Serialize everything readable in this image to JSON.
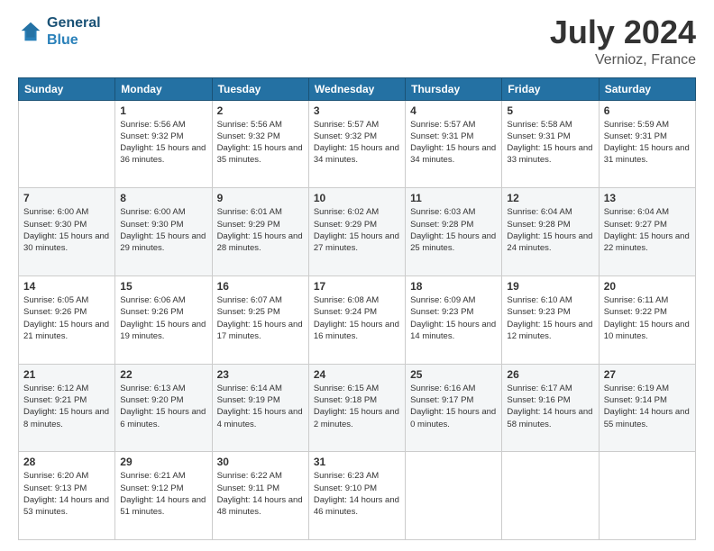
{
  "header": {
    "logo_line1": "General",
    "logo_line2": "Blue",
    "title": "July 2024",
    "subtitle": "Vernioz, France"
  },
  "days_of_week": [
    "Sunday",
    "Monday",
    "Tuesday",
    "Wednesday",
    "Thursday",
    "Friday",
    "Saturday"
  ],
  "weeks": [
    [
      {
        "day": "",
        "sunrise": "",
        "sunset": "",
        "daylight": ""
      },
      {
        "day": "1",
        "sunrise": "Sunrise: 5:56 AM",
        "sunset": "Sunset: 9:32 PM",
        "daylight": "Daylight: 15 hours and 36 minutes."
      },
      {
        "day": "2",
        "sunrise": "Sunrise: 5:56 AM",
        "sunset": "Sunset: 9:32 PM",
        "daylight": "Daylight: 15 hours and 35 minutes."
      },
      {
        "day": "3",
        "sunrise": "Sunrise: 5:57 AM",
        "sunset": "Sunset: 9:32 PM",
        "daylight": "Daylight: 15 hours and 34 minutes."
      },
      {
        "day": "4",
        "sunrise": "Sunrise: 5:57 AM",
        "sunset": "Sunset: 9:31 PM",
        "daylight": "Daylight: 15 hours and 34 minutes."
      },
      {
        "day": "5",
        "sunrise": "Sunrise: 5:58 AM",
        "sunset": "Sunset: 9:31 PM",
        "daylight": "Daylight: 15 hours and 33 minutes."
      },
      {
        "day": "6",
        "sunrise": "Sunrise: 5:59 AM",
        "sunset": "Sunset: 9:31 PM",
        "daylight": "Daylight: 15 hours and 31 minutes."
      }
    ],
    [
      {
        "day": "7",
        "sunrise": "Sunrise: 6:00 AM",
        "sunset": "Sunset: 9:30 PM",
        "daylight": "Daylight: 15 hours and 30 minutes."
      },
      {
        "day": "8",
        "sunrise": "Sunrise: 6:00 AM",
        "sunset": "Sunset: 9:30 PM",
        "daylight": "Daylight: 15 hours and 29 minutes."
      },
      {
        "day": "9",
        "sunrise": "Sunrise: 6:01 AM",
        "sunset": "Sunset: 9:29 PM",
        "daylight": "Daylight: 15 hours and 28 minutes."
      },
      {
        "day": "10",
        "sunrise": "Sunrise: 6:02 AM",
        "sunset": "Sunset: 9:29 PM",
        "daylight": "Daylight: 15 hours and 27 minutes."
      },
      {
        "day": "11",
        "sunrise": "Sunrise: 6:03 AM",
        "sunset": "Sunset: 9:28 PM",
        "daylight": "Daylight: 15 hours and 25 minutes."
      },
      {
        "day": "12",
        "sunrise": "Sunrise: 6:04 AM",
        "sunset": "Sunset: 9:28 PM",
        "daylight": "Daylight: 15 hours and 24 minutes."
      },
      {
        "day": "13",
        "sunrise": "Sunrise: 6:04 AM",
        "sunset": "Sunset: 9:27 PM",
        "daylight": "Daylight: 15 hours and 22 minutes."
      }
    ],
    [
      {
        "day": "14",
        "sunrise": "Sunrise: 6:05 AM",
        "sunset": "Sunset: 9:26 PM",
        "daylight": "Daylight: 15 hours and 21 minutes."
      },
      {
        "day": "15",
        "sunrise": "Sunrise: 6:06 AM",
        "sunset": "Sunset: 9:26 PM",
        "daylight": "Daylight: 15 hours and 19 minutes."
      },
      {
        "day": "16",
        "sunrise": "Sunrise: 6:07 AM",
        "sunset": "Sunset: 9:25 PM",
        "daylight": "Daylight: 15 hours and 17 minutes."
      },
      {
        "day": "17",
        "sunrise": "Sunrise: 6:08 AM",
        "sunset": "Sunset: 9:24 PM",
        "daylight": "Daylight: 15 hours and 16 minutes."
      },
      {
        "day": "18",
        "sunrise": "Sunrise: 6:09 AM",
        "sunset": "Sunset: 9:23 PM",
        "daylight": "Daylight: 15 hours and 14 minutes."
      },
      {
        "day": "19",
        "sunrise": "Sunrise: 6:10 AM",
        "sunset": "Sunset: 9:23 PM",
        "daylight": "Daylight: 15 hours and 12 minutes."
      },
      {
        "day": "20",
        "sunrise": "Sunrise: 6:11 AM",
        "sunset": "Sunset: 9:22 PM",
        "daylight": "Daylight: 15 hours and 10 minutes."
      }
    ],
    [
      {
        "day": "21",
        "sunrise": "Sunrise: 6:12 AM",
        "sunset": "Sunset: 9:21 PM",
        "daylight": "Daylight: 15 hours and 8 minutes."
      },
      {
        "day": "22",
        "sunrise": "Sunrise: 6:13 AM",
        "sunset": "Sunset: 9:20 PM",
        "daylight": "Daylight: 15 hours and 6 minutes."
      },
      {
        "day": "23",
        "sunrise": "Sunrise: 6:14 AM",
        "sunset": "Sunset: 9:19 PM",
        "daylight": "Daylight: 15 hours and 4 minutes."
      },
      {
        "day": "24",
        "sunrise": "Sunrise: 6:15 AM",
        "sunset": "Sunset: 9:18 PM",
        "daylight": "Daylight: 15 hours and 2 minutes."
      },
      {
        "day": "25",
        "sunrise": "Sunrise: 6:16 AM",
        "sunset": "Sunset: 9:17 PM",
        "daylight": "Daylight: 15 hours and 0 minutes."
      },
      {
        "day": "26",
        "sunrise": "Sunrise: 6:17 AM",
        "sunset": "Sunset: 9:16 PM",
        "daylight": "Daylight: 14 hours and 58 minutes."
      },
      {
        "day": "27",
        "sunrise": "Sunrise: 6:19 AM",
        "sunset": "Sunset: 9:14 PM",
        "daylight": "Daylight: 14 hours and 55 minutes."
      }
    ],
    [
      {
        "day": "28",
        "sunrise": "Sunrise: 6:20 AM",
        "sunset": "Sunset: 9:13 PM",
        "daylight": "Daylight: 14 hours and 53 minutes."
      },
      {
        "day": "29",
        "sunrise": "Sunrise: 6:21 AM",
        "sunset": "Sunset: 9:12 PM",
        "daylight": "Daylight: 14 hours and 51 minutes."
      },
      {
        "day": "30",
        "sunrise": "Sunrise: 6:22 AM",
        "sunset": "Sunset: 9:11 PM",
        "daylight": "Daylight: 14 hours and 48 minutes."
      },
      {
        "day": "31",
        "sunrise": "Sunrise: 6:23 AM",
        "sunset": "Sunset: 9:10 PM",
        "daylight": "Daylight: 14 hours and 46 minutes."
      },
      {
        "day": "",
        "sunrise": "",
        "sunset": "",
        "daylight": ""
      },
      {
        "day": "",
        "sunrise": "",
        "sunset": "",
        "daylight": ""
      },
      {
        "day": "",
        "sunrise": "",
        "sunset": "",
        "daylight": ""
      }
    ]
  ]
}
